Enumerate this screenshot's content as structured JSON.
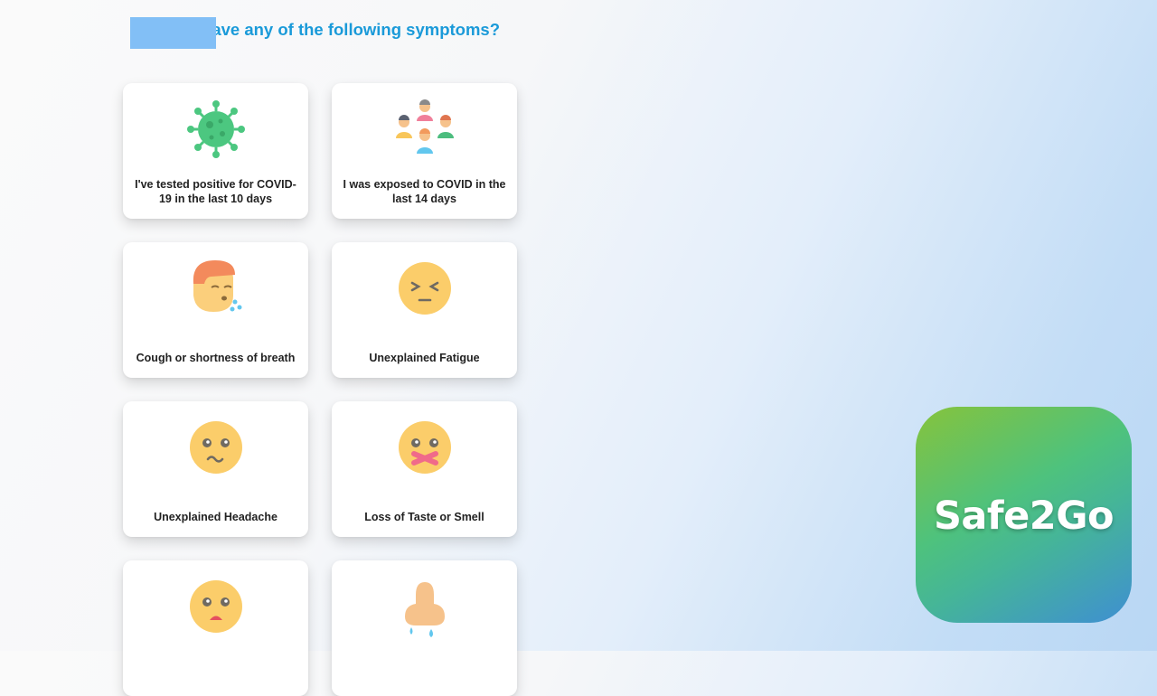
{
  "question": {
    "text": ", do you have any of the following symptoms?",
    "name_placeholder": ""
  },
  "symptoms": [
    {
      "label": "I've tested positive for COVID-19 in the last 10 days",
      "icon": "virus-icon"
    },
    {
      "label": "I was exposed to COVID in the last 14 days",
      "icon": "people-group-icon"
    },
    {
      "label": "Cough or shortness of breath",
      "icon": "coughing-person-icon"
    },
    {
      "label": "Unexplained Fatigue",
      "icon": "tired-face-icon"
    },
    {
      "label": "Unexplained Headache",
      "icon": "woozy-face-icon"
    },
    {
      "label": "Loss of Taste or Smell",
      "icon": "taped-mouth-face-icon"
    },
    {
      "label": "",
      "icon": "sad-face-icon"
    },
    {
      "label": "",
      "icon": "runny-nose-icon"
    }
  ],
  "brand": {
    "name": "Safe2Go",
    "colors": [
      "#86c33c",
      "#4ec27d",
      "#3f8fd2"
    ]
  },
  "accent_color": "#1a9ad9"
}
